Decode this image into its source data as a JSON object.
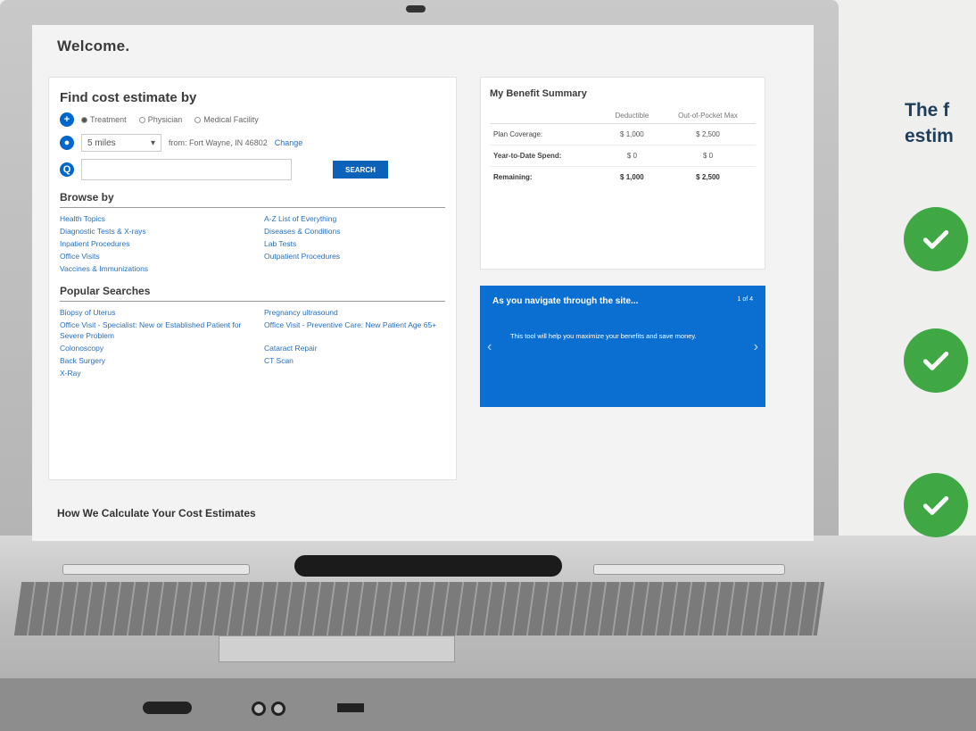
{
  "welcome": "Welcome.",
  "find": {
    "title": "Find cost estimate by",
    "radios": [
      "Treatment",
      "Physician",
      "Medical Facility"
    ],
    "distance": "5 miles",
    "location": "from: Fort Wayne, IN 46802",
    "change": "Change",
    "search_btn": "SEARCH"
  },
  "browse": {
    "title": "Browse by",
    "items": [
      "Health Topics",
      "A-Z List of Everything",
      "Diagnostic Tests & X-rays",
      "Diseases & Conditions",
      "Inpatient Procedures",
      "Lab Tests",
      "Office Visits",
      "Outpatient Procedures",
      "Vaccines & Immunizations"
    ]
  },
  "popular": {
    "title": "Popular Searches",
    "items": [
      "Biopsy of Uterus",
      "Pregnancy ultrasound",
      "Office Visit - Specialist: New or Established Patient for Severe Problem",
      "Office Visit - Preventive Care: New Patient Age 65+",
      "Colonoscopy",
      "Cataract Repair",
      "Back Surgery",
      "CT Scan",
      "X-Ray"
    ]
  },
  "benefit": {
    "title": "My Benefit Summary",
    "col1": "Deductible",
    "col2": "Out-of-Pocket Max",
    "rows": [
      {
        "label": "Plan Coverage:",
        "ded": "$ 1,000",
        "oop": "$ 2,500"
      },
      {
        "label": "Year-to-Date Spend:",
        "ded": "$ 0",
        "oop": "$ 0"
      },
      {
        "label": "Remaining:",
        "ded": "$ 1,000",
        "oop": "$ 2,500"
      }
    ]
  },
  "tip": {
    "title": "As you navigate through the site...",
    "count": "1 of 4",
    "body": "This tool will help you maximize your benefits and save money."
  },
  "how": "How We Calculate Your Cost Estimates",
  "right": {
    "line1": "The f",
    "line2": "estim"
  },
  "colors": {
    "accent": "#0b6fd1",
    "check": "#3fa844",
    "heading": "#1e3e5c"
  }
}
